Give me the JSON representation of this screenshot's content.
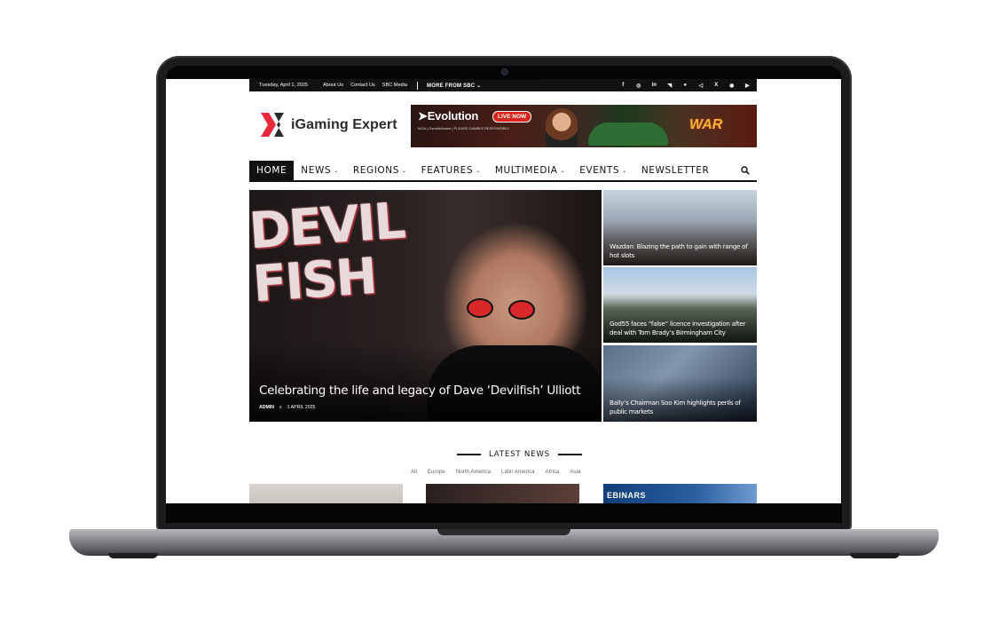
{
  "topbar": {
    "date": "Tuesday, April 1, 2025",
    "links": [
      "About Us",
      "Contact Us",
      "SBC Media"
    ],
    "more": "MORE FROM SBC",
    "socials": [
      "facebook-icon",
      "instagram-icon",
      "linkedin-icon",
      "rss-icon",
      "spotify-icon",
      "telegram-icon",
      "x-icon",
      "podcast-icon",
      "youtube-icon"
    ],
    "social_glyphs": [
      "f",
      "◎",
      "in",
      "◥",
      "●",
      "◁",
      "X",
      "◉",
      "▶"
    ]
  },
  "header": {
    "logo_text": "iGaming Expert",
    "logo_colors": {
      "red": "#e8283a",
      "dark": "#2b2b2b"
    },
    "banner": {
      "brand": "Evolution",
      "badge": "LIVE NOW",
      "fine_print": "MGA | GambleAware | PLEASE GAMBLE RESPONSIBLY",
      "game": "WAR"
    }
  },
  "nav": {
    "items": [
      {
        "label": "HOME",
        "active": true
      },
      {
        "label": "NEWS",
        "has_dropdown": true
      },
      {
        "label": "REGIONS",
        "has_dropdown": true
      },
      {
        "label": "FEATURES",
        "has_dropdown": true
      },
      {
        "label": "MULTIMEDIA",
        "has_dropdown": true
      },
      {
        "label": "EVENTS",
        "has_dropdown": true
      },
      {
        "label": "NEWSLETTER"
      }
    ],
    "chevron": "⌄",
    "search_icon": "search-icon"
  },
  "hero": {
    "image_text": "DEVIL FISH",
    "title": "Celebrating the life and legacy of Dave ‘Devilfish’ Ulliott",
    "author": "ADMIN",
    "separator": "x",
    "date": "1 APRIL 2025"
  },
  "side_stories": [
    {
      "title": "Wazdan: Blazing the path to gain with range of hot slots"
    },
    {
      "title": "God55 faces “false” licence investigation after deal with Tom Brady’s Birmingham City"
    },
    {
      "title": "Bally’s Chairman Soo Kim highlights perils of public markets"
    }
  ],
  "latest": {
    "heading": "LATEST NEWS",
    "filters": [
      "All",
      "Europe",
      "North America",
      "Latin America",
      "Africa",
      "Asia"
    ],
    "card3_label": "EBINARS"
  }
}
